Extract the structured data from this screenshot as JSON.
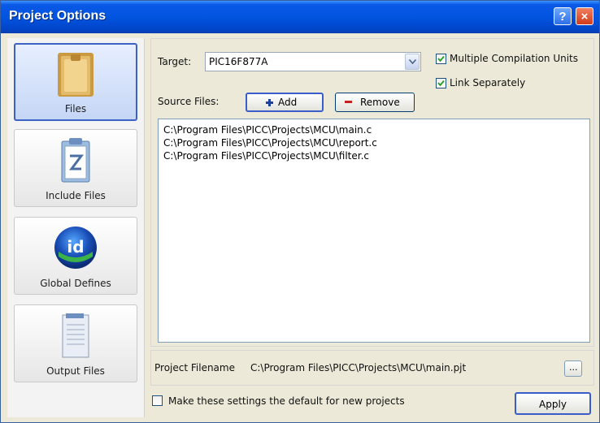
{
  "window": {
    "title": "Project Options",
    "help_button": "?",
    "close_button": "×"
  },
  "sidebar": {
    "items": [
      {
        "label": "Files",
        "icon": "folder-icon",
        "active": true
      },
      {
        "label": "Include Files",
        "icon": "clipboard-icon",
        "active": false
      },
      {
        "label": "Global Defines",
        "icon": "id-globe-icon",
        "active": false
      },
      {
        "label": "Output Files",
        "icon": "document-icon",
        "active": false
      }
    ]
  },
  "files_panel": {
    "target_label": "Target:",
    "target_value": "PIC16F877A",
    "multiple_units_label": "Multiple Compilation Units",
    "multiple_units_checked": true,
    "link_separately_label": "Link Separately",
    "link_separately_checked": true,
    "source_files_label": "Source Files:",
    "add_button": "Add",
    "remove_button": "Remove",
    "source_files": [
      "C:\\Program Files\\PICC\\Projects\\MCU\\main.c",
      "C:\\Program Files\\PICC\\Projects\\MCU\\report.c",
      "C:\\Program Files\\PICC\\Projects\\MCU\\filter.c"
    ],
    "project_filename_label": "Project Filename",
    "project_filename_value": "C:\\Program Files\\PICC\\Projects\\MCU\\main.pjt",
    "browse_button": "...",
    "default_settings_label": "Make these settings the default for new projects",
    "default_settings_checked": false,
    "apply_button": "Apply"
  },
  "colors": {
    "titlebar": "#0255e0",
    "active_nav_border": "#3b62c4",
    "checkbox_tick": "#21a121"
  }
}
